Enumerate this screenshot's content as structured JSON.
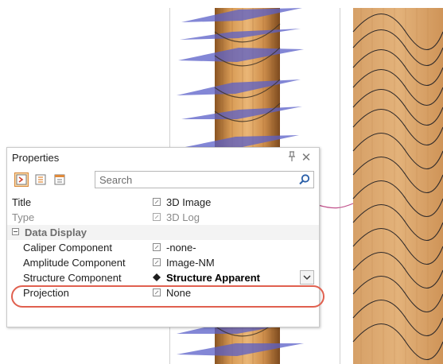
{
  "panel": {
    "title": "Properties",
    "pin_glyph": "ᵖ",
    "close_glyph": "✕"
  },
  "toolbar": {
    "buttons": [
      {
        "icon": "categorized-view-icon",
        "active": true
      },
      {
        "icon": "alphabetical-view-icon",
        "active": false
      },
      {
        "icon": "property-pages-icon",
        "active": false
      }
    ],
    "search_placeholder": "Search"
  },
  "rows": [
    {
      "kind": "property",
      "name": "Title",
      "value": "3D Image",
      "muted": false
    },
    {
      "kind": "property",
      "name": "Type",
      "value": "3D Log",
      "muted": true
    },
    {
      "kind": "category",
      "name": "Data Display",
      "expanded": true
    },
    {
      "kind": "property",
      "name": "Caliper Component",
      "value": "-none-",
      "muted": false,
      "indent": true
    },
    {
      "kind": "property",
      "name": "Amplitude Component",
      "value": "Image-NM",
      "muted": false,
      "indent": true
    },
    {
      "kind": "property",
      "name": "Structure Component",
      "value": "Structure Apparent",
      "muted": false,
      "indent": true,
      "selected": true,
      "has_dropdown": true
    },
    {
      "kind": "property",
      "name": "Projection",
      "value": "None",
      "muted": false,
      "indent": true
    }
  ],
  "colors": {
    "accent_active": "#f8d8a8",
    "highlight_ring": "#e0604f",
    "log_wood": "#c98a4a",
    "dip_planes": "#5a5fc8"
  }
}
